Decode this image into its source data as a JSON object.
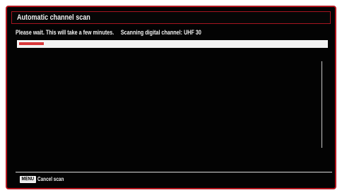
{
  "dialog": {
    "title": "Automatic channel scan",
    "status_message": "Please wait. This will take a few minutes.",
    "scan_status": "Scanning digital channel: UHF 30",
    "progress_fraction": 0.08,
    "accent_color": "#b3161f",
    "progress_color": "#d9383a"
  },
  "footer": {
    "key_label": "MENU",
    "action_label": "Cancel scan"
  }
}
